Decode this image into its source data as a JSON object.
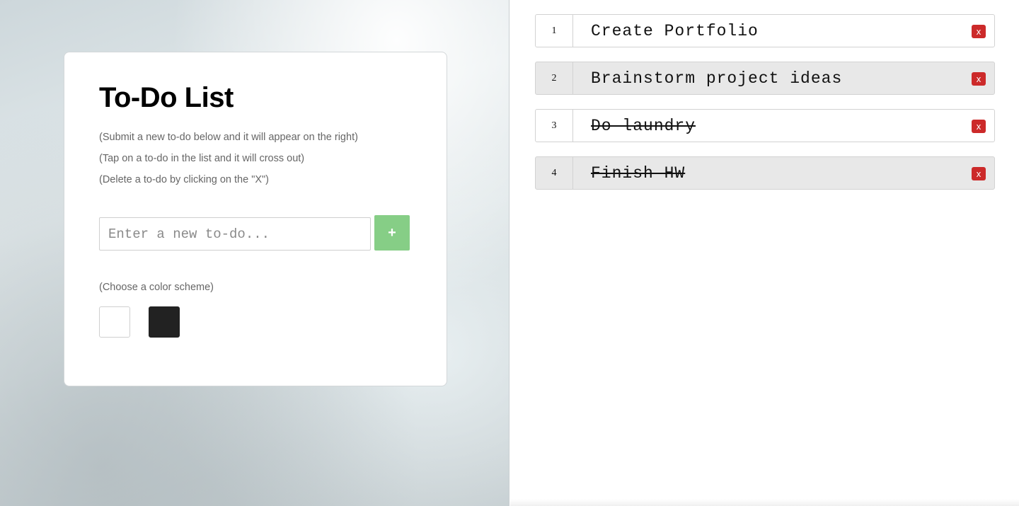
{
  "form": {
    "title": "To-Do List",
    "hints": [
      "(Submit a new to-do below and it will appear on the right)",
      "(Tap on a to-do in the list and it will cross out)",
      "(Delete a to-do by clicking on the \"X\")"
    ],
    "input_placeholder": "Enter a new to-do...",
    "add_label": "+",
    "color_scheme_label": "(Choose a color scheme)",
    "schemes": [
      {
        "name": "light",
        "color": "#ffffff"
      },
      {
        "name": "dark",
        "color": "#222222"
      }
    ],
    "accent_color": "#86ce86"
  },
  "todos": [
    {
      "num": "1",
      "text": "Create Portfolio",
      "done": false,
      "shaded": false,
      "delete_label": "x"
    },
    {
      "num": "2",
      "text": "Brainstorm project ideas",
      "done": false,
      "shaded": true,
      "delete_label": "x"
    },
    {
      "num": "3",
      "text": "Do laundry",
      "done": true,
      "shaded": false,
      "delete_label": "x"
    },
    {
      "num": "4",
      "text": "Finish HW",
      "done": true,
      "shaded": true,
      "delete_label": "x"
    }
  ],
  "delete_color": "#cc2a2a"
}
